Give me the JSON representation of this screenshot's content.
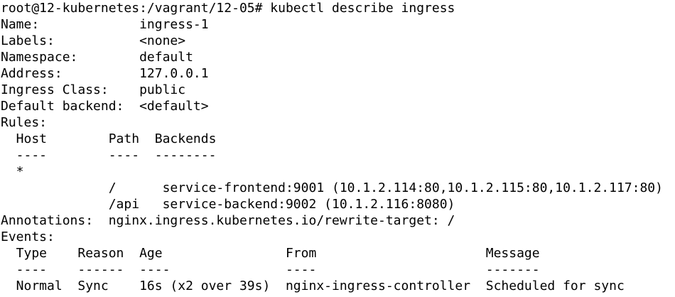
{
  "terminal": {
    "background": "#ffffff",
    "foreground": "#000000",
    "lines": [
      "root@12-kubernetes:/vagrant/12-05# kubectl describe ingress",
      "Name:             ingress-1",
      "Labels:           <none>",
      "Namespace:        default",
      "Address:          127.0.0.1",
      "Ingress Class:    public",
      "Default backend:  <default>",
      "Rules:",
      "  Host        Path  Backends",
      "  ----        ----  --------",
      "  *",
      "              /      service-frontend:9001 (10.1.2.114:80,10.1.2.115:80,10.1.2.117:80)",
      "              /api   service-backend:9002 (10.1.2.116:8080)",
      "Annotations:  nginx.ingress.kubernetes.io/rewrite-target: /",
      "Events:",
      "  Type    Reason  Age                From                      Message",
      "  ----    ------  ----               ----                      -------",
      "  Normal  Sync    16s (x2 over 39s)  nginx-ingress-controller  Scheduled for sync"
    ]
  }
}
